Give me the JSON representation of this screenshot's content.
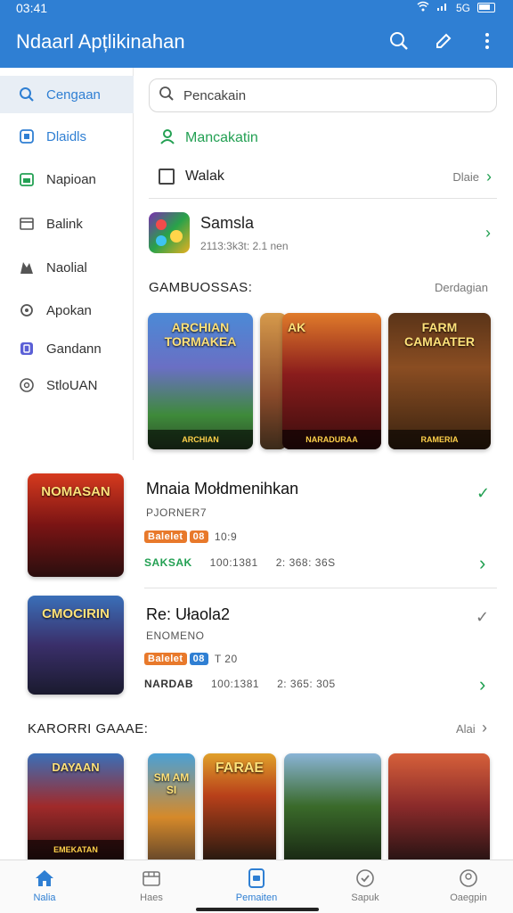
{
  "status": {
    "time": "03:41",
    "signal": "5G",
    "battery": "88"
  },
  "appbar": {
    "title": "Ndaarl Apțlikinahan",
    "search_icon": "search-icon",
    "edit_icon": "pencil-icon",
    "more_icon": "more-vert-icon"
  },
  "sidebar": {
    "items": [
      {
        "label": "Cengaan",
        "icon": "search-icon",
        "active": true
      },
      {
        "label": "Dlaidls",
        "icon": "apps-icon"
      },
      {
        "label": "Napioan",
        "icon": "calendar-icon"
      },
      {
        "label": "Balink",
        "icon": "window-icon"
      },
      {
        "label": "Naolial",
        "icon": "map-icon"
      },
      {
        "label": "Apokan",
        "icon": "gear-icon"
      },
      {
        "label": "Gandann",
        "icon": "badge-icon"
      },
      {
        "label": "StloUAN",
        "icon": "info-icon"
      }
    ]
  },
  "search": {
    "placeholder": "Pencakain"
  },
  "user_row": {
    "label": "Mancakatin"
  },
  "filter_row": {
    "label": "Walak",
    "right_label": "Dlaie"
  },
  "featured_app": {
    "title": "Samsla",
    "subtitle": "2113:3k3t: 2.1 nen"
  },
  "section1": {
    "title": "GAMBUOSSAS:",
    "more": "Derdagian",
    "cards": [
      {
        "top": "ARCHIAN TORMAKEA",
        "caption": "ARCHIAN"
      },
      {
        "top": "",
        "caption": ""
      },
      {
        "top": "AK",
        "caption": "NARADURAA"
      },
      {
        "top": "FARM CAMAATER",
        "caption": "RAMERIA"
      }
    ]
  },
  "games": [
    {
      "title": "Mnaia Mołdmenihkan",
      "code": "PJORNER7",
      "badge1": "Balelet",
      "badge2": "08",
      "count": "10:9",
      "label": "SAKSAK",
      "meta1": "100:1381",
      "meta2": "2: 368: 36S",
      "thumb_text": "NOMASAN"
    },
    {
      "title": "Re: Ułaola2",
      "code": "ENOMENO",
      "badge1": "Balelet",
      "badge2": "08",
      "count": "T 20",
      "label": "NARDAB",
      "meta1": "100:1381",
      "meta2": "2: 365: 305",
      "thumb_text": "CMOCIRIN"
    }
  ],
  "section2": {
    "title": "KARORRI GAAAE:",
    "more": "Alai",
    "cards": [
      {
        "top": "DAYAAN",
        "caption": "EMEKATAN"
      },
      {
        "top": "SM AM SI",
        "caption": ""
      },
      {
        "top": "FARAE",
        "caption": ""
      },
      {
        "top": "",
        "caption": ""
      },
      {
        "top": "",
        "caption": ""
      }
    ]
  },
  "bottomnav": {
    "items": [
      {
        "label": "Nalia",
        "icon": "home-icon",
        "active": true
      },
      {
        "label": "Haes",
        "icon": "store-icon"
      },
      {
        "label": "Pemaiten",
        "icon": "tablet-icon"
      },
      {
        "label": "Sapuk",
        "icon": "check-circle-icon"
      },
      {
        "label": "Oaegpin",
        "icon": "person-circle-icon"
      }
    ]
  },
  "colors": {
    "primary": "#2f7fd3",
    "green": "#23a053",
    "orange": "#e8792b"
  }
}
